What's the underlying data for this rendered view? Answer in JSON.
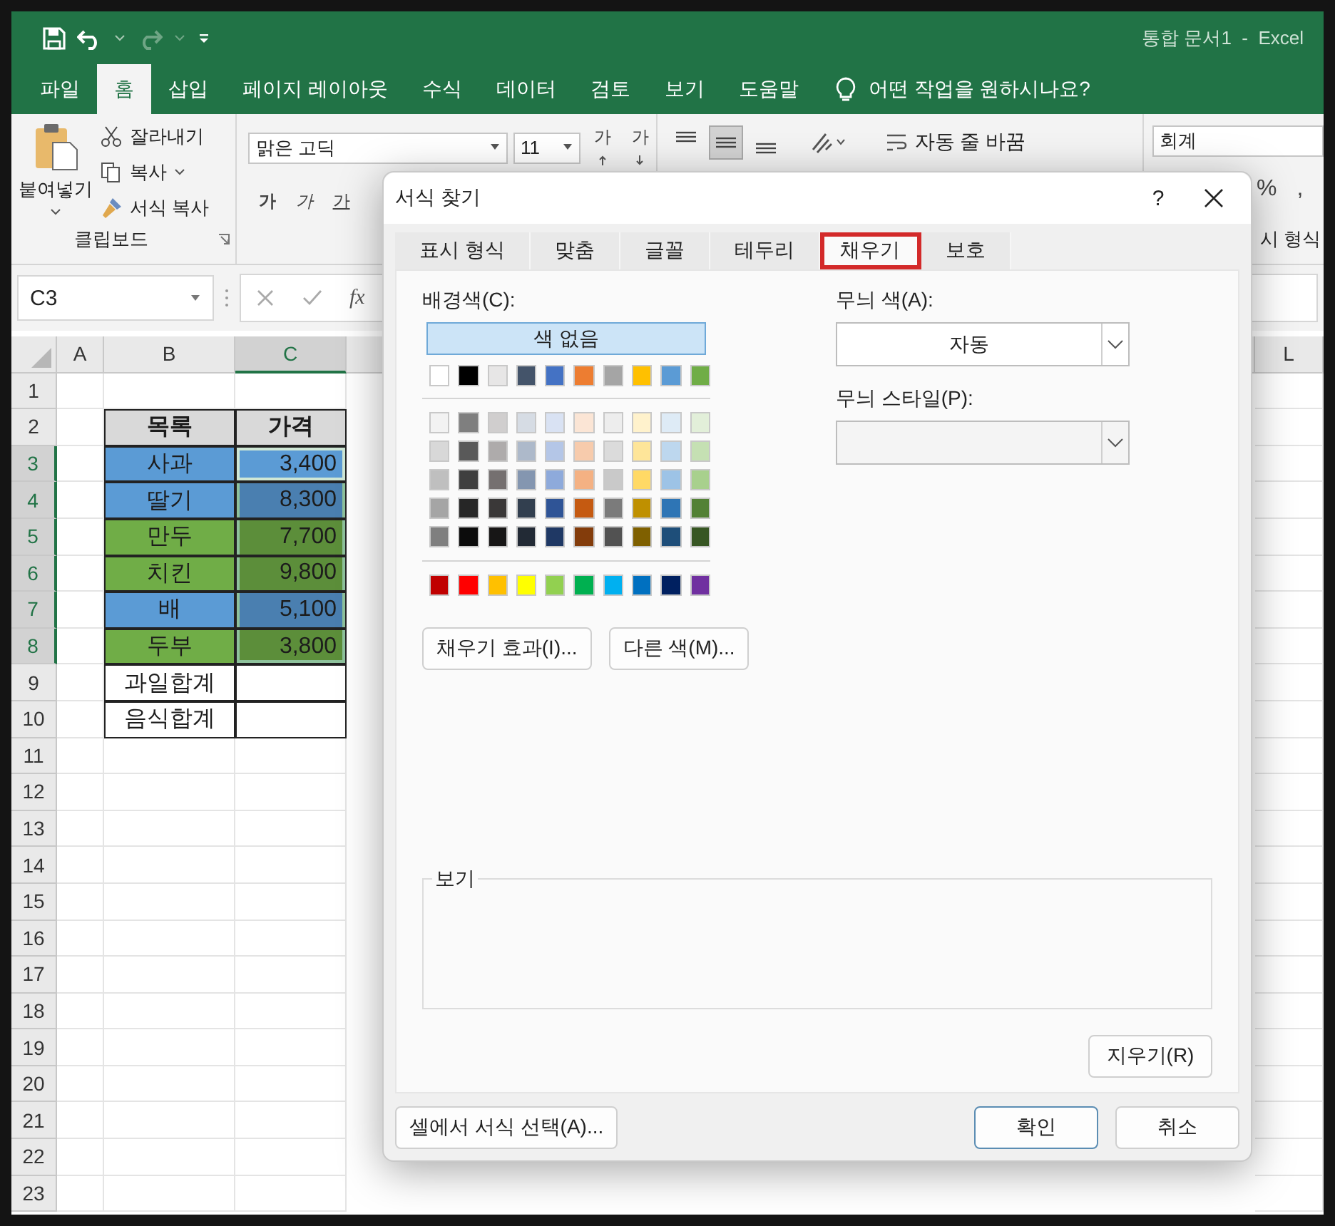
{
  "title": "통합 문서1  -  Excel",
  "ribbon_tabs": [
    {
      "label": "파일",
      "selected": false
    },
    {
      "label": "홈",
      "selected": true
    },
    {
      "label": "삽입",
      "selected": false
    },
    {
      "label": "페이지 레이아웃",
      "selected": false
    },
    {
      "label": "수식",
      "selected": false
    },
    {
      "label": "데이터",
      "selected": false
    },
    {
      "label": "검토",
      "selected": false
    },
    {
      "label": "보기",
      "selected": false
    },
    {
      "label": "도움말",
      "selected": false
    }
  ],
  "tell_me": "어떤 작업을 원하시나요?",
  "clipboard": {
    "paste": "붙여넣기",
    "cut": "잘라내기",
    "copy": "복사",
    "format_painter": "서식 복사",
    "group_label": "클립보드"
  },
  "font": {
    "name": "맑은 고딕",
    "size": "11",
    "grow": "가",
    "shrink": "가",
    "bold": "가",
    "italic": "가",
    "underline": "가"
  },
  "alignment": {
    "buttons": [
      {
        "kind": "top",
        "selected": false
      },
      {
        "kind": "middle",
        "selected": true
      },
      {
        "kind": "bottom",
        "selected": false
      }
    ],
    "wrap_text": "자동 줄 바꿈"
  },
  "number": {
    "format": "회계",
    "percent": "%",
    "comma": ",",
    "group_label": "시 형식"
  },
  "formula_bar": {
    "name_box": "C3",
    "fx": "fx"
  },
  "columns": [
    {
      "label": "A",
      "selected": false
    },
    {
      "label": "B",
      "selected": false
    },
    {
      "label": "C",
      "selected": true
    },
    {
      "label": "L",
      "selected": false
    }
  ],
  "row_headers": [
    {
      "label": "1",
      "selected": false
    },
    {
      "label": "2",
      "selected": false
    },
    {
      "label": "3",
      "selected": true
    },
    {
      "label": "4",
      "selected": true
    },
    {
      "label": "5",
      "selected": true
    },
    {
      "label": "6",
      "selected": true
    },
    {
      "label": "7",
      "selected": true
    },
    {
      "label": "8",
      "selected": true
    },
    {
      "label": "9",
      "selected": false
    },
    {
      "label": "10",
      "selected": false
    },
    {
      "label": "11",
      "selected": false
    },
    {
      "label": "12",
      "selected": false
    },
    {
      "label": "13",
      "selected": false
    },
    {
      "label": "14",
      "selected": false
    },
    {
      "label": "15",
      "selected": false
    },
    {
      "label": "16",
      "selected": false
    },
    {
      "label": "17",
      "selected": false
    },
    {
      "label": "18",
      "selected": false
    },
    {
      "label": "19",
      "selected": false
    },
    {
      "label": "20",
      "selected": false
    },
    {
      "label": "21",
      "selected": false
    },
    {
      "label": "22",
      "selected": false
    },
    {
      "label": "23",
      "selected": false
    }
  ],
  "table": {
    "header": [
      "목록",
      "가격"
    ],
    "rows": [
      {
        "item": {
          "text": "사과",
          "color": "#5b9bd5"
        },
        "price": {
          "text": "3,400",
          "color": "#5b9bd5",
          "selected": true
        }
      },
      {
        "item": {
          "text": "딸기",
          "color": "#5b9bd5"
        },
        "price": {
          "text": "8,300",
          "color": "#4a7fb0",
          "selected": true
        }
      },
      {
        "item": {
          "text": "만두",
          "color": "#70ad47"
        },
        "price": {
          "text": "7,700",
          "color": "#5c8e3a",
          "selected": true
        }
      },
      {
        "item": {
          "text": "치킨",
          "color": "#70ad47"
        },
        "price": {
          "text": "9,800",
          "color": "#5c8e3a",
          "selected": true
        }
      },
      {
        "item": {
          "text": "배",
          "color": "#5b9bd5"
        },
        "price": {
          "text": "5,100",
          "color": "#4a7fb0",
          "selected": true
        }
      },
      {
        "item": {
          "text": "두부",
          "color": "#70ad47"
        },
        "price": {
          "text": "3,800",
          "color": "#5c8e3a",
          "selected": true
        }
      },
      {
        "item": {
          "text": "과일합계"
        },
        "price": {
          "selected": false
        }
      },
      {
        "item": {
          "text": "음식합계"
        },
        "price": {
          "selected": false
        }
      }
    ]
  },
  "dialog": {
    "title": "서식 찾기",
    "help": "?",
    "tabs": [
      {
        "label": "표시 형식",
        "selected": false
      },
      {
        "label": "맞춤",
        "selected": false
      },
      {
        "label": "글꼴",
        "selected": false
      },
      {
        "label": "테두리",
        "selected": false
      },
      {
        "label": "채우기",
        "selected": true
      },
      {
        "label": "보호",
        "selected": false
      }
    ],
    "background_label": "배경색(C):",
    "no_color": "색 없음",
    "theme_colors": [
      {
        "color": "#ffffff"
      },
      {
        "color": "#000000"
      },
      {
        "color": "#e7e6e6"
      },
      {
        "color": "#44546a"
      },
      {
        "color": "#4472c4"
      },
      {
        "color": "#ed7d31"
      },
      {
        "color": "#a5a5a5"
      },
      {
        "color": "#ffc000"
      },
      {
        "color": "#5b9bd5"
      },
      {
        "color": "#70ad47"
      }
    ],
    "tints": [
      [
        {
          "color": "#f2f2f2"
        },
        {
          "color": "#7f7f7f"
        },
        {
          "color": "#d0cece"
        },
        {
          "color": "#d6dce4"
        },
        {
          "color": "#d9e2f3"
        },
        {
          "color": "#fbe5d5"
        },
        {
          "color": "#ededed"
        },
        {
          "color": "#fff2cc"
        },
        {
          "color": "#deebf6"
        },
        {
          "color": "#e2efd9"
        }
      ],
      [
        {
          "color": "#d8d8d8"
        },
        {
          "color": "#595959"
        },
        {
          "color": "#aeabab"
        },
        {
          "color": "#adb9ca"
        },
        {
          "color": "#b4c6e7"
        },
        {
          "color": "#f7cbac"
        },
        {
          "color": "#dbdbdb"
        },
        {
          "color": "#fee599"
        },
        {
          "color": "#bdd7ee"
        },
        {
          "color": "#c5e0b3"
        }
      ],
      [
        {
          "color": "#bfbfbf"
        },
        {
          "color": "#3f3f3f"
        },
        {
          "color": "#757070"
        },
        {
          "color": "#8496b0"
        },
        {
          "color": "#8eaadb"
        },
        {
          "color": "#f4b183"
        },
        {
          "color": "#c9c9c9"
        },
        {
          "color": "#ffd965"
        },
        {
          "color": "#9dc3e6"
        },
        {
          "color": "#a8d08d"
        }
      ],
      [
        {
          "color": "#a5a5a5"
        },
        {
          "color": "#262626"
        },
        {
          "color": "#3a3838"
        },
        {
          "color": "#323f4f"
        },
        {
          "color": "#2f5496"
        },
        {
          "color": "#c55a11"
        },
        {
          "color": "#7b7b7b"
        },
        {
          "color": "#bf9000"
        },
        {
          "color": "#2e75b5"
        },
        {
          "color": "#538135"
        }
      ],
      [
        {
          "color": "#7f7f7f"
        },
        {
          "color": "#0c0c0c"
        },
        {
          "color": "#171616"
        },
        {
          "color": "#222a35"
        },
        {
          "color": "#1f3864"
        },
        {
          "color": "#833c0b"
        },
        {
          "color": "#525252"
        },
        {
          "color": "#7f6000"
        },
        {
          "color": "#1e4e79"
        },
        {
          "color": "#375623"
        }
      ]
    ],
    "standard_colors": [
      {
        "color": "#c00000"
      },
      {
        "color": "#ff0000"
      },
      {
        "color": "#ffc000"
      },
      {
        "color": "#ffff00"
      },
      {
        "color": "#92d050"
      },
      {
        "color": "#00b050"
      },
      {
        "color": "#00b0f0"
      },
      {
        "color": "#0070c0"
      },
      {
        "color": "#002060"
      },
      {
        "color": "#7030a0"
      }
    ],
    "fill_effects": "채우기 효과(I)...",
    "more_colors": "다른 색(M)...",
    "pattern_color_label": "무늬 색(A):",
    "pattern_color": "자동",
    "pattern_style_label": "무늬 스타일(P):",
    "sample_label": "보기",
    "clear": "지우기(R)",
    "choose_from_cell": "셀에서 서식 선택(A)...",
    "ok": "확인",
    "cancel": "취소"
  }
}
